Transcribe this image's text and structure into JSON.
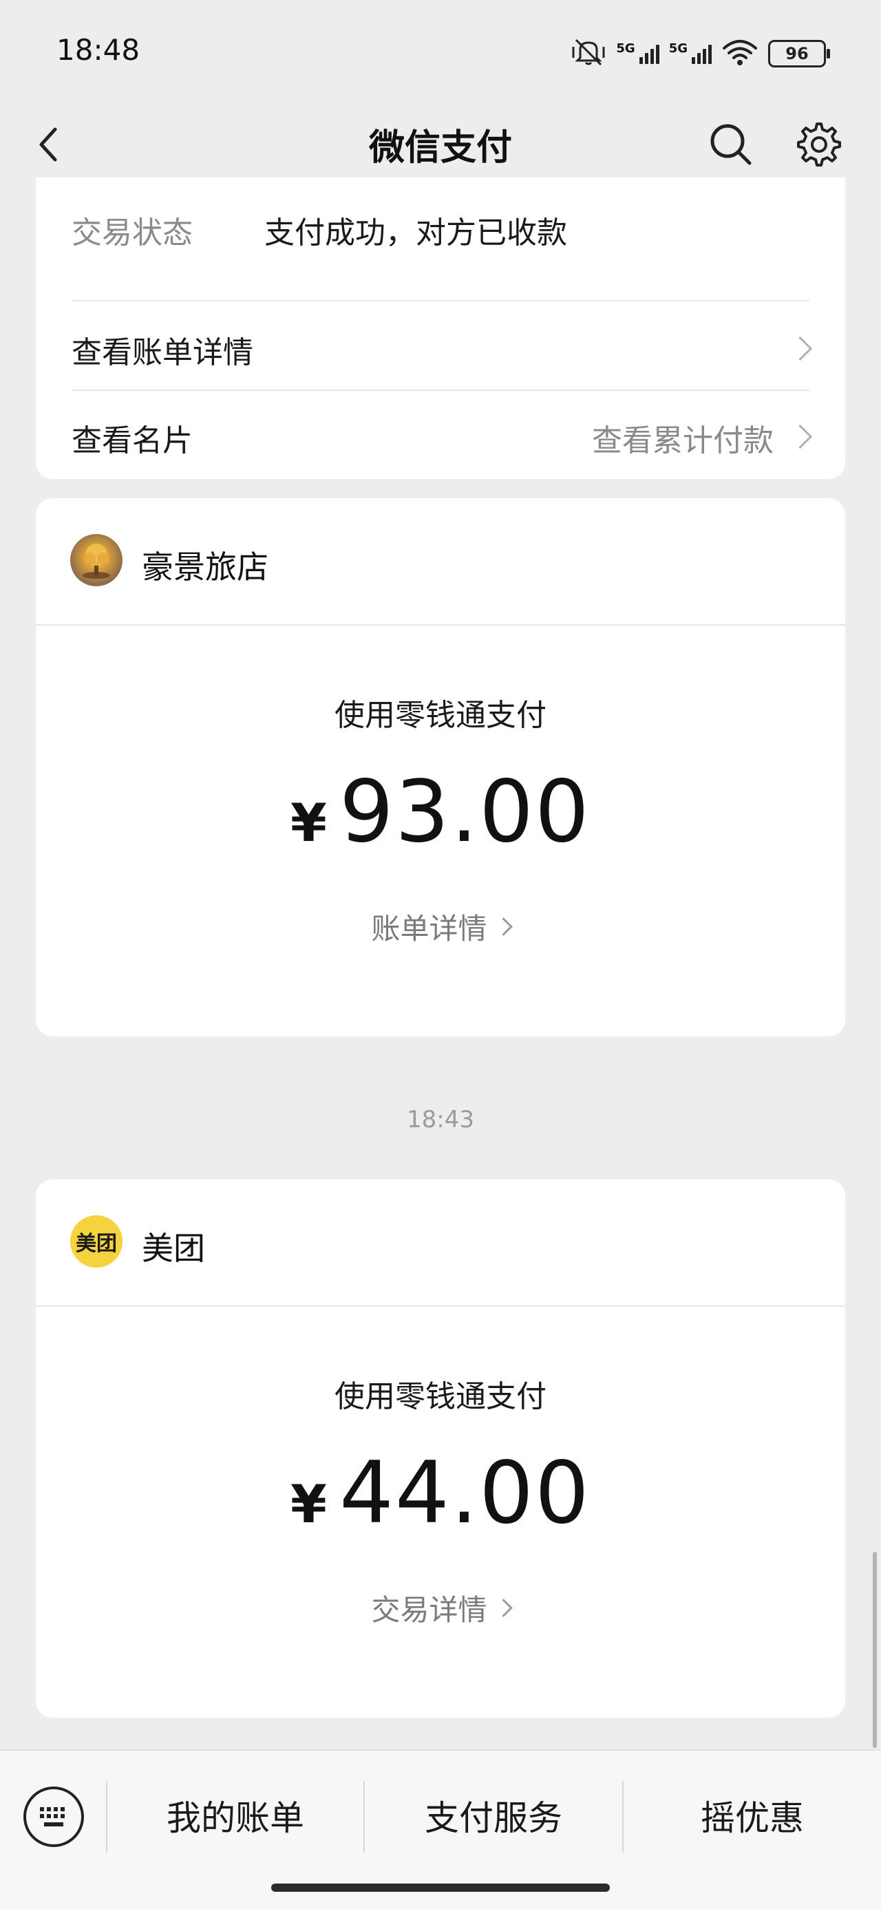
{
  "status_bar": {
    "time": "18:48",
    "network_1": "5G",
    "network_2": "5G",
    "battery": "96",
    "icons": [
      "mute-icon",
      "signal-icon",
      "signal-icon",
      "wifi-icon",
      "battery-icon"
    ]
  },
  "nav": {
    "title": "微信支付",
    "icons": [
      "back-icon",
      "search-icon",
      "settings-icon"
    ]
  },
  "top_card": {
    "status_label": "交易状态",
    "status_value": "支付成功，对方已收款",
    "view_bill": "查看账单详情",
    "view_card": "查看名片",
    "view_cumulative": "查看累计付款"
  },
  "payments": [
    {
      "merchant": "豪景旅店",
      "method": "使用零钱通支付",
      "currency": "¥",
      "amount": "93.00",
      "detail_link": "账单详情"
    },
    {
      "merchant": "美团",
      "logo_text": "美团",
      "method": "使用零钱通支付",
      "currency": "¥",
      "amount": "44.00",
      "detail_link": "交易详情"
    }
  ],
  "timestamp": "18:43",
  "bottom_bar": {
    "items": [
      "我的账单",
      "支付服务",
      "摇优惠"
    ],
    "keyboard_icon": "keyboard-icon"
  },
  "colors": {
    "background": "#ededed",
    "card": "#ffffff",
    "meituan_yellow": "#f5d23e"
  }
}
